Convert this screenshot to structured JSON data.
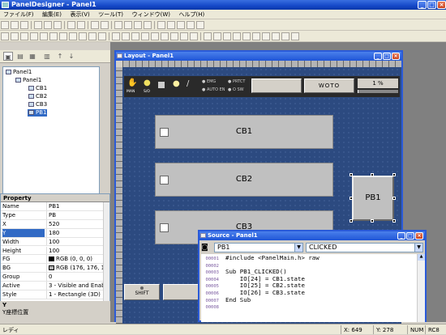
{
  "app": {
    "title": "PanelDesigner - Panel1"
  },
  "menu": [
    "ファイル(F)",
    "編集(E)",
    "表示(V)",
    "ツール(T)",
    "ウィンドウ(W)",
    "ヘルプ(H)"
  ],
  "tree": {
    "items": [
      "Panel1",
      "Panel1",
      "CB1",
      "CB2",
      "CB3",
      "PB1"
    ]
  },
  "property": {
    "header": "Property",
    "rows": [
      {
        "k": "Name",
        "v": "PB1"
      },
      {
        "k": "Type",
        "v": "PB"
      },
      {
        "k": "X",
        "v": "520"
      },
      {
        "k": "Y",
        "v": "180"
      },
      {
        "k": "Width",
        "v": "100"
      },
      {
        "k": "Height",
        "v": "100"
      },
      {
        "k": "FG",
        "v": "RGB (0, 0, 0)",
        "color": "#000000"
      },
      {
        "k": "BG",
        "v": "RGB (176, 176, 1",
        "color": "#b0b0b0"
      },
      {
        "k": "Group",
        "v": "0"
      },
      {
        "k": "Active",
        "v": "3 - Visible and Enab"
      },
      {
        "k": "Style",
        "v": "1 - Rectangle (3D)"
      }
    ],
    "desc_title": "Y",
    "desc_text": "Y座標位置"
  },
  "layout": {
    "title": "Layout - Panel1",
    "top_icons": [
      "MAN",
      "S/O"
    ],
    "indicators": [
      "EMG",
      "AUTO EN",
      "PRTCT",
      "O SW"
    ],
    "woto_label": "WOTO",
    "percent_label": "1 %",
    "checkboxes": [
      "CB1",
      "CB2",
      "CB3"
    ],
    "pb1_label": "PB1",
    "shift_label": "SHIFT"
  },
  "source": {
    "title": "Source - Panel1",
    "object_select": "PB1",
    "event_select": "CLICKED",
    "lines": [
      {
        "n": "00001",
        "t": "#include <PanelMain.h> raw"
      },
      {
        "n": "00002",
        "t": ""
      },
      {
        "n": "00003",
        "t": "Sub PB1_CLICKED()"
      },
      {
        "n": "00004",
        "t": "    IO[24] = CB1.state"
      },
      {
        "n": "00005",
        "t": "    IO[25] = CB2.state"
      },
      {
        "n": "00006",
        "t": "    IO[26] = CB3.state"
      },
      {
        "n": "00007",
        "t": "End Sub"
      },
      {
        "n": "00008",
        "t": ""
      }
    ]
  },
  "status": {
    "left": "レディ",
    "x": "X: 649",
    "y": "Y: 278",
    "num": "NUM",
    "rc": "RC8"
  }
}
